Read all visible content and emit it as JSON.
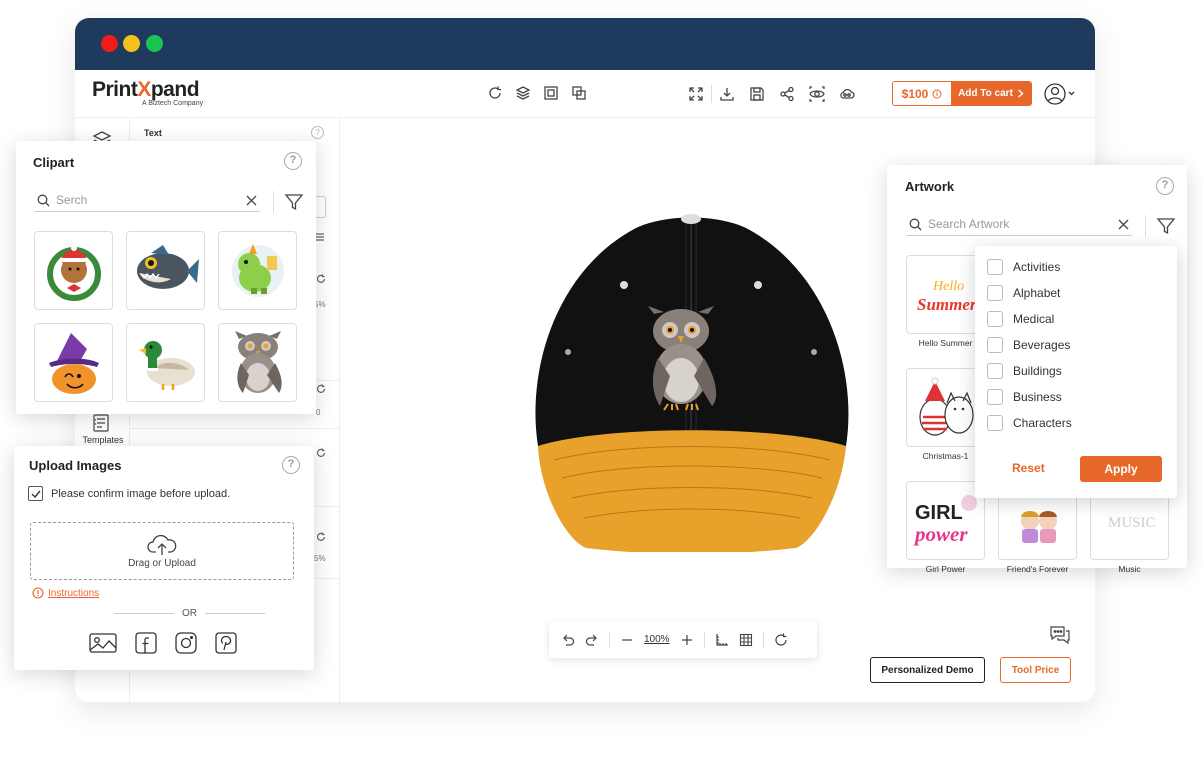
{
  "app": {
    "logo_main_a": "Print",
    "logo_main_b": "X",
    "logo_main_c": "pand",
    "logo_sub": "A Biztech Company"
  },
  "header": {
    "price": "$100",
    "cart_label": "Add To cart"
  },
  "left_rail": {
    "templates_label": "Templates"
  },
  "sub_panel": {
    "text_label": "Text",
    "pct_a": "5%",
    "pct_b": "0",
    "pct_c": "5%"
  },
  "clipart": {
    "title": "Clipart",
    "search_placeholder": "Serch",
    "items": [
      "teddy-bear",
      "piranha-fish",
      "green-dinosaur",
      "pumpkin-witch",
      "mallard-duck",
      "grey-owl"
    ]
  },
  "upload": {
    "title": "Upload Images",
    "confirm_label": "Please confirm image before upload.",
    "drop_label": "Drag or Upload",
    "instructions_label": "Instructions",
    "or_label": "OR"
  },
  "artwork": {
    "title": "Artwork",
    "search_placeholder": "Search Artwork",
    "items": [
      {
        "label": "Hello Summer"
      },
      {
        "label": ""
      },
      {
        "label": ""
      },
      {
        "label": "Christmas-1"
      },
      {
        "label": ""
      },
      {
        "label": ""
      },
      {
        "label": "Girl Power"
      },
      {
        "label": "Friend's Forever"
      },
      {
        "label": "Music"
      }
    ],
    "art_text": {
      "hello": "Hello",
      "summer": "Summer",
      "girl": "GIRL",
      "power": "power",
      "music": "MUSIC"
    }
  },
  "filter": {
    "options": [
      "Activities",
      "Alphabet",
      "Medical",
      "Beverages",
      "Buildings",
      "Business",
      "Characters"
    ],
    "reset_label": "Reset",
    "apply_label": "Apply"
  },
  "canvas": {
    "zoom": "100%",
    "demo_label": "Personalized Demo",
    "tool_price_label": "Tool Price"
  },
  "colors": {
    "accent": "#e8672a",
    "titlebar": "#1e3a5c",
    "cap_crown": "#111111",
    "cap_brim": "#e8a12a"
  }
}
